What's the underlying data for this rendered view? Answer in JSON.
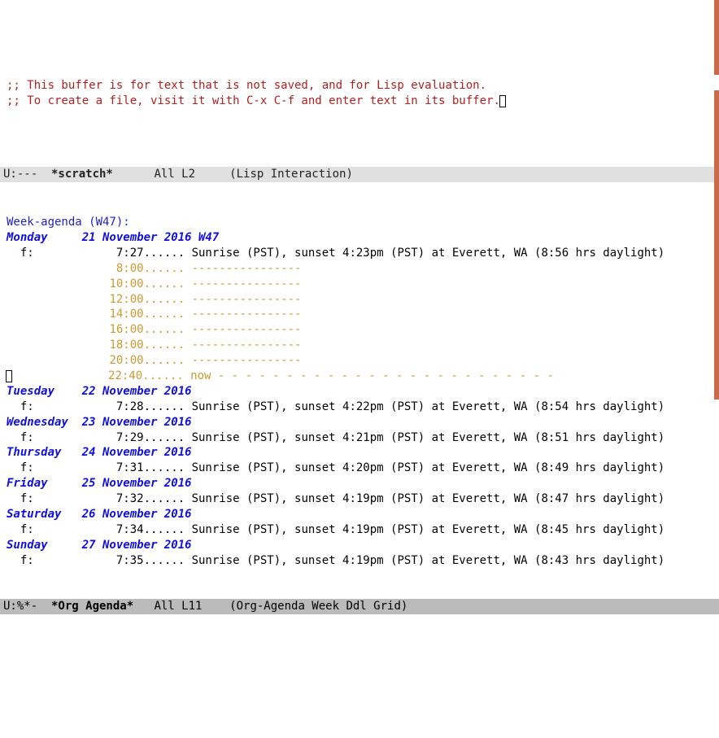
{
  "scratch": {
    "comment1": ";; This buffer is for text that is not saved, and for Lisp evaluation.",
    "comment2": ";; To create a file, visit it with C-x C-f and enter text in its buffer."
  },
  "modeline_top": {
    "status": "U:--- ",
    "buffer": " *scratch*",
    "pos": "      All L2    ",
    "mode": " (Lisp Interaction)"
  },
  "agenda": {
    "header": "Week-agenda (W47):",
    "days": [
      {
        "label": "Monday     21 November 2016 W47",
        "today": true,
        "entries": [
          {
            "prefix": "  f:            ",
            "time": "7:27",
            "dots": "...... ",
            "text": "Sunrise (PST), sunset 4:23pm (PST) at Everett, WA (8:56 hrs daylight)",
            "style": "entry"
          },
          {
            "prefix": "               ",
            "time": " 8:00",
            "dots": "...... ",
            "text": "----------------",
            "style": "grid"
          },
          {
            "prefix": "               ",
            "time": "10:00",
            "dots": "...... ",
            "text": "----------------",
            "style": "grid"
          },
          {
            "prefix": "               ",
            "time": "12:00",
            "dots": "...... ",
            "text": "----------------",
            "style": "grid"
          },
          {
            "prefix": "               ",
            "time": "14:00",
            "dots": "...... ",
            "text": "----------------",
            "style": "grid"
          },
          {
            "prefix": "               ",
            "time": "16:00",
            "dots": "...... ",
            "text": "----------------",
            "style": "grid"
          },
          {
            "prefix": "               ",
            "time": "18:00",
            "dots": "...... ",
            "text": "----------------",
            "style": "grid"
          },
          {
            "prefix": "               ",
            "time": "20:00",
            "dots": "...... ",
            "text": "----------------",
            "style": "grid"
          },
          {
            "prefix": "               ",
            "time": "22:40",
            "dots": "...... ",
            "text": "now - - - - - - - - - - - - - - - - - - - - - - - - -",
            "style": "now",
            "cursor": true
          }
        ]
      },
      {
        "label": "Tuesday    22 November 2016",
        "today": false,
        "entries": [
          {
            "prefix": "  f:            ",
            "time": "7:28",
            "dots": "...... ",
            "text": "Sunrise (PST), sunset 4:22pm (PST) at Everett, WA (8:54 hrs daylight)",
            "style": "entry"
          }
        ]
      },
      {
        "label": "Wednesday  23 November 2016",
        "today": false,
        "entries": [
          {
            "prefix": "  f:            ",
            "time": "7:29",
            "dots": "...... ",
            "text": "Sunrise (PST), sunset 4:21pm (PST) at Everett, WA (8:51 hrs daylight)",
            "style": "entry"
          }
        ]
      },
      {
        "label": "Thursday   24 November 2016",
        "today": false,
        "entries": [
          {
            "prefix": "  f:            ",
            "time": "7:31",
            "dots": "...... ",
            "text": "Sunrise (PST), sunset 4:20pm (PST) at Everett, WA (8:49 hrs daylight)",
            "style": "entry"
          }
        ]
      },
      {
        "label": "Friday     25 November 2016",
        "today": false,
        "entries": [
          {
            "prefix": "  f:            ",
            "time": "7:32",
            "dots": "...... ",
            "text": "Sunrise (PST), sunset 4:19pm (PST) at Everett, WA (8:47 hrs daylight)",
            "style": "entry"
          }
        ]
      },
      {
        "label": "Saturday   26 November 2016",
        "today": false,
        "entries": [
          {
            "prefix": "  f:            ",
            "time": "7:34",
            "dots": "...... ",
            "text": "Sunrise (PST), sunset 4:19pm (PST) at Everett, WA (8:45 hrs daylight)",
            "style": "entry"
          }
        ]
      },
      {
        "label": "Sunday     27 November 2016",
        "today": false,
        "entries": [
          {
            "prefix": "  f:            ",
            "time": "7:35",
            "dots": "...... ",
            "text": "Sunrise (PST), sunset 4:19pm (PST) at Everett, WA (8:43 hrs daylight)",
            "style": "entry"
          }
        ]
      }
    ]
  },
  "modeline_bottom": {
    "status": "U:%*- ",
    "buffer": " *Org Agenda*",
    "pos": "   All L11   ",
    "mode": " (Org-Agenda Week Ddl Grid)"
  }
}
